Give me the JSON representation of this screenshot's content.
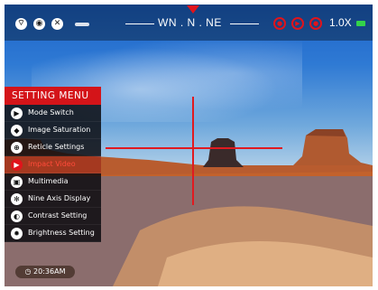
{
  "status_bar": {
    "left_icons": [
      "wifi-icon",
      "camera-icon",
      "settings-icon"
    ],
    "compass": "WN . N . NE",
    "record_icons": [
      "rec-photo-icon",
      "rec-video-icon",
      "rec-audio-icon"
    ],
    "zoom": "1.0X",
    "battery_color": "#33d34a"
  },
  "menu": {
    "title": "SETTING MENU",
    "items": [
      {
        "label": "Mode Switch",
        "icon": "mode-switch-icon"
      },
      {
        "label": "Image Saturation",
        "icon": "saturation-icon"
      },
      {
        "label": "Reticle Settings",
        "icon": "reticle-icon"
      },
      {
        "label": "Impact Video",
        "icon": "impact-video-icon"
      },
      {
        "label": "Multimedia",
        "icon": "multimedia-icon"
      },
      {
        "label": "Nine Axis Display",
        "icon": "nine-axis-icon"
      },
      {
        "label": "Contrast Setting",
        "icon": "contrast-icon"
      },
      {
        "label": "Brightness Setting",
        "icon": "brightness-icon"
      }
    ],
    "selected_index": 3
  },
  "time": "20:36AM",
  "accent_color": "#e0141b"
}
